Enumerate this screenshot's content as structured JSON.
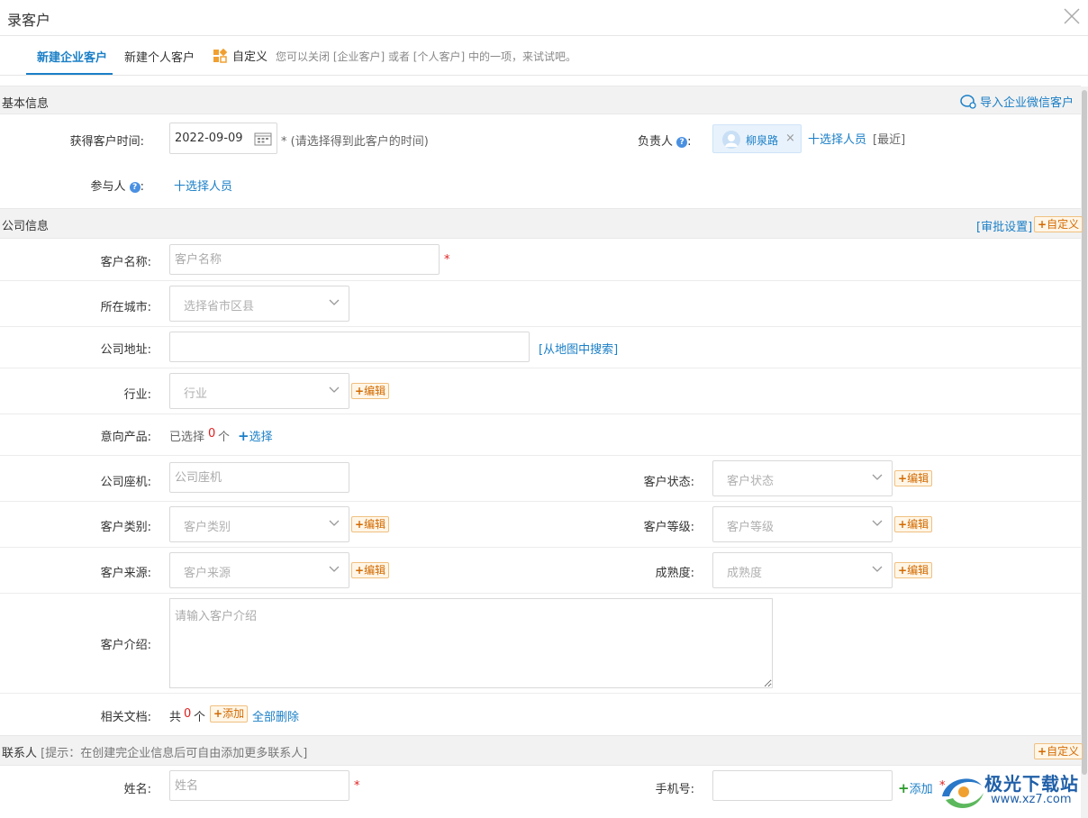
{
  "dialog": {
    "title": "录客户"
  },
  "tabs": {
    "company": "新建企业客户",
    "personal": "新建个人客户",
    "custom": "自定义",
    "hint": "您可以关闭 [企业客户] 或者 [个人客户] 中的一项，来试试吧。"
  },
  "basic": {
    "title": "基本信息",
    "import_wechat": "导入企业微信客户",
    "acquire_time_label": "获得客户时间:",
    "acquire_time_value": "2022-09-09",
    "acquire_time_hint": "* (请选择得到此客户的时间)",
    "owner_label": "负责人",
    "owner_name": "柳泉路",
    "select_person": "十选择人员",
    "recent": "[最近]",
    "participant_label": "参与人",
    "participant_select": "十选择人员"
  },
  "company": {
    "title": "公司信息",
    "approval_settings": "[审批设置]",
    "customize": "自定义",
    "name_label": "客户名称:",
    "name_placeholder": "客户名称",
    "city_label": "所在城市:",
    "city_placeholder": "选择省市区县",
    "address_label": "公司地址:",
    "map_search": "[从地图中搜索]",
    "industry_label": "行业:",
    "industry_placeholder": "行业",
    "edit": "编辑",
    "product_label": "意向产品:",
    "product_selected_prefix": "已选择",
    "product_count": "0",
    "product_unit": "个",
    "product_select": "选择",
    "phone_label": "公司座机:",
    "phone_placeholder": "公司座机",
    "status_label": "客户状态:",
    "status_placeholder": "客户状态",
    "category_label": "客户类别:",
    "category_placeholder": "客户类别",
    "level_label": "客户等级:",
    "level_placeholder": "客户等级",
    "source_label": "客户来源:",
    "source_placeholder": "客户来源",
    "maturity_label": "成熟度:",
    "maturity_placeholder": "成熟度",
    "intro_label": "客户介绍:",
    "intro_placeholder": "请输入客户介绍",
    "docs_label": "相关文档:",
    "docs_prefix": "共",
    "docs_count": "0",
    "docs_unit": "个",
    "docs_add": "添加",
    "docs_delete_all": "全部删除"
  },
  "contact": {
    "title": "联系人",
    "hint": "[提示：在创建完企业信息后可自由添加更多联系人]",
    "customize": "自定义",
    "name_label": "姓名:",
    "name_placeholder": "姓名",
    "mobile_label": "手机号:",
    "add": "添加"
  },
  "watermark": {
    "text": "极光下载站",
    "sub": "www.xz7.com"
  },
  "colors": {
    "accent": "#1a7fc7",
    "required": "#e02020",
    "edit": "#d26a00"
  }
}
